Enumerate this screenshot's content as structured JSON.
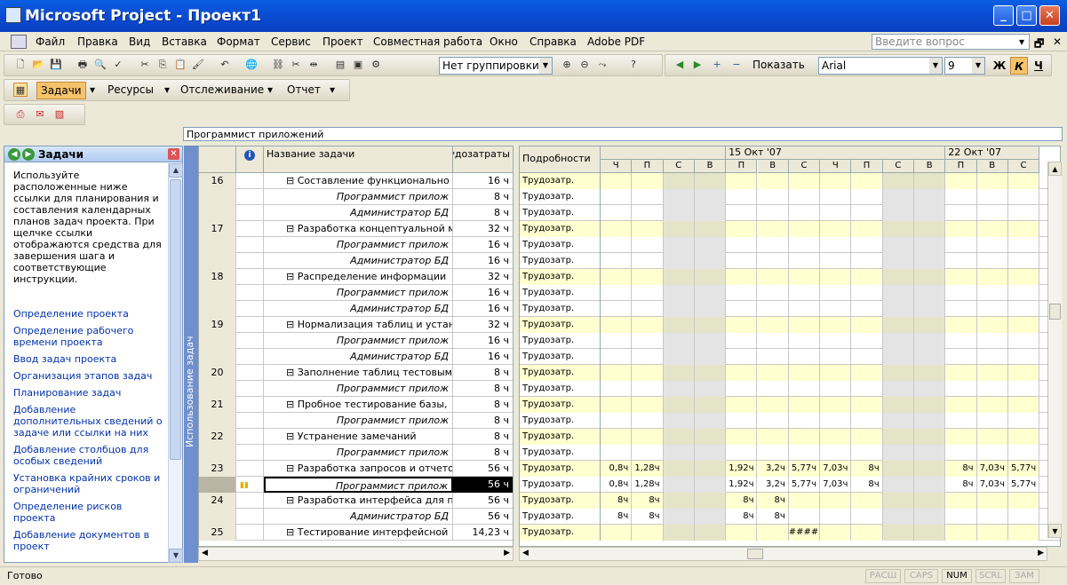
{
  "window": {
    "title": "Microsoft Project - Проект1",
    "min": "_",
    "max": "□",
    "close": "✕"
  },
  "menu": {
    "items": [
      "Файл",
      "Правка",
      "Вид",
      "Вставка",
      "Формат",
      "Сервис",
      "Проект",
      "Совместная работа",
      "Окно",
      "Справка",
      "Adobe PDF"
    ],
    "help_placeholder": "Введите вопрос"
  },
  "toolbar": {
    "grouping": "Нет группировки",
    "show": "Показать",
    "font": "Arial",
    "size": "9",
    "bold": "Ж",
    "italic": "К",
    "underline": "Ч"
  },
  "guide": {
    "tasks": "Задачи",
    "resources": "Ресурсы",
    "tracking": "Отслеживание",
    "report": "Отчет"
  },
  "entry": "Программист приложений",
  "taskpane": {
    "title": "Задачи",
    "intro": "Используйте расположенные ниже ссылки для планирования и составления календарных планов задач проекта. При щелчке ссылки отображаются средства для завершения шага и соответствующие инструкции.",
    "links": [
      "Определение проекта",
      "Определение рабочего времени проекта",
      "Ввод задач проекта",
      "Организация этапов задач",
      "Планирование задач",
      "Добавление дополнительных сведений о задаче или ссылки на них",
      "Добавление столбцов для особых сведений",
      "Установка крайних сроков и ограничений",
      "Определение рисков проекта",
      "Добавление документов в проект"
    ]
  },
  "viewbar": "Использование задач",
  "grid": {
    "headers": {
      "info": "i",
      "name": "Название задачи",
      "work": "Трудозатраты"
    },
    "rows": [
      {
        "id": "16",
        "name": "Составление функционально",
        "work": "16 ч",
        "type": "sum"
      },
      {
        "id": "",
        "name": "Программист прилож",
        "work": "8 ч",
        "type": "res"
      },
      {
        "id": "",
        "name": "Администратор БД",
        "work": "8 ч",
        "type": "res"
      },
      {
        "id": "17",
        "name": "Разработка концептуальной м",
        "work": "32 ч",
        "type": "sum"
      },
      {
        "id": "",
        "name": "Программист прилож",
        "work": "16 ч",
        "type": "res"
      },
      {
        "id": "",
        "name": "Администратор БД",
        "work": "16 ч",
        "type": "res"
      },
      {
        "id": "18",
        "name": "Распределение информации",
        "work": "32 ч",
        "type": "sum"
      },
      {
        "id": "",
        "name": "Программист прилож",
        "work": "16 ч",
        "type": "res"
      },
      {
        "id": "",
        "name": "Администратор БД",
        "work": "16 ч",
        "type": "res"
      },
      {
        "id": "19",
        "name": "Нормализация таблиц и устан",
        "work": "32 ч",
        "type": "sum"
      },
      {
        "id": "",
        "name": "Программист прилож",
        "work": "16 ч",
        "type": "res"
      },
      {
        "id": "",
        "name": "Администратор БД",
        "work": "16 ч",
        "type": "res"
      },
      {
        "id": "20",
        "name": "Заполнение таблиц тестовым",
        "work": "8 ч",
        "type": "sum"
      },
      {
        "id": "",
        "name": "Программист прилож",
        "work": "8 ч",
        "type": "res"
      },
      {
        "id": "21",
        "name": "Пробное тестирование базы,",
        "work": "8 ч",
        "type": "sum"
      },
      {
        "id": "",
        "name": "Программист прилож",
        "work": "8 ч",
        "type": "res"
      },
      {
        "id": "22",
        "name": "Устранение замечаний",
        "work": "8 ч",
        "type": "sum"
      },
      {
        "id": "",
        "name": "Программист прилож",
        "work": "8 ч",
        "type": "res"
      },
      {
        "id": "23",
        "name": "Разработка запросов и отчето",
        "work": "56 ч",
        "type": "sum"
      },
      {
        "id": "",
        "name": "Программист прилож",
        "work": "56 ч",
        "type": "res",
        "sel": true
      },
      {
        "id": "24",
        "name": "Разработка интерфейса для п",
        "work": "56 ч",
        "type": "sum"
      },
      {
        "id": "",
        "name": "Администратор БД",
        "work": "56 ч",
        "type": "res"
      },
      {
        "id": "25",
        "name": "Тестирование интерфейсной",
        "work": "14,23 ч",
        "type": "sum"
      }
    ]
  },
  "timeline": {
    "detail_header": "Подробности",
    "detail_label": "Трудозатр.",
    "weeks": [
      {
        "label": "",
        "days": [
          "Ч",
          "П",
          "С",
          "В"
        ]
      },
      {
        "label": "15 Окт '07",
        "days": [
          "П",
          "В",
          "С",
          "Ч",
          "П",
          "С",
          "В"
        ]
      },
      {
        "label": "22 Окт '07",
        "days": [
          "П",
          "В",
          "С"
        ]
      }
    ],
    "values": {
      "18": [
        "0,8ч",
        "1,28ч",
        "",
        "",
        "1,92ч",
        "3,2ч",
        "5,77ч",
        "7,03ч",
        "8ч",
        "",
        "",
        "8ч",
        "7,03ч",
        "5,77ч"
      ],
      "19": [
        "0,8ч",
        "1,28ч",
        "",
        "",
        "1,92ч",
        "3,2ч",
        "5,77ч",
        "7,03ч",
        "8ч",
        "",
        "",
        "8ч",
        "7,03ч",
        "5,77ч"
      ],
      "20": [
        "8ч",
        "8ч",
        "",
        "",
        "8ч",
        "8ч",
        "",
        "",
        "",
        "",
        "",
        "",
        "",
        ""
      ],
      "21": [
        "8ч",
        "8ч",
        "",
        "",
        "8ч",
        "8ч",
        "",
        "",
        "",
        "",
        "",
        "",
        "",
        ""
      ],
      "22": [
        "",
        "",
        "",
        "",
        "",
        "",
        "#####",
        "",
        "",
        "",
        "",
        "",
        "",
        ""
      ]
    }
  },
  "status": {
    "text": "Готово",
    "indicators": [
      "РАСШ",
      "CAPS",
      "NUM",
      "SCRL",
      "ЗАМ"
    ],
    "active": "NUM"
  }
}
